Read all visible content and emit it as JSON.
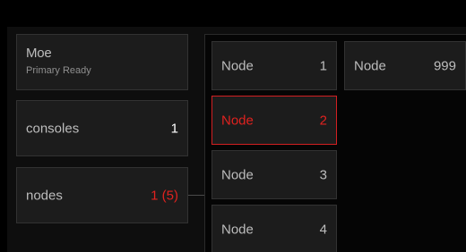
{
  "status_card": {
    "name": "Moe",
    "status": "Primary Ready"
  },
  "stats": [
    {
      "label": "consoles",
      "value": "1",
      "value_color": "#ffffff"
    },
    {
      "label": "nodes",
      "value": "1 (5)",
      "value_color": "#e0221f"
    }
  ],
  "nodes": [
    {
      "label": "Node",
      "number": "1",
      "selected": false
    },
    {
      "label": "Node",
      "number": "2",
      "selected": true
    },
    {
      "label": "Node",
      "number": "3",
      "selected": false
    },
    {
      "label": "Node",
      "number": "4",
      "selected": false
    },
    {
      "label": "Node",
      "number": "999",
      "selected": false
    }
  ],
  "colors": {
    "background": "#000000",
    "tile": "#1c1c1c",
    "accent_red": "#e0221f",
    "text": "#bdbdbd"
  }
}
